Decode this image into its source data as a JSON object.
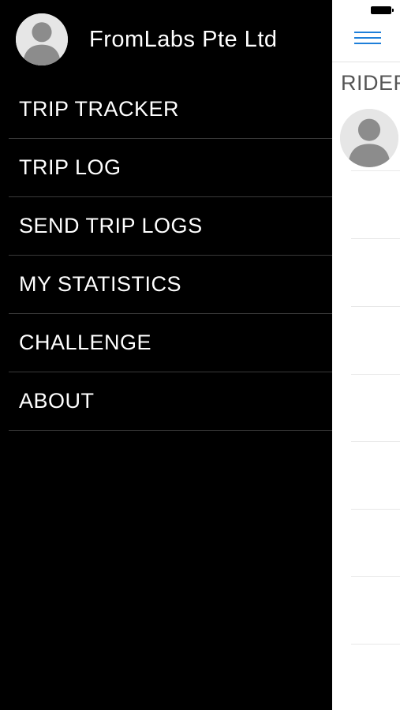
{
  "drawer": {
    "profile": {
      "name": "FromLabs Pte Ltd",
      "avatar_icon": "person-silhouette-icon"
    },
    "menu": [
      {
        "label": "TRIP TRACKER"
      },
      {
        "label": "TRIP LOG"
      },
      {
        "label": "SEND TRIP LOGS"
      },
      {
        "label": "MY STATISTICS"
      },
      {
        "label": "CHALLENGE"
      },
      {
        "label": "ABOUT"
      }
    ]
  },
  "main": {
    "menu_icon": "hamburger-icon",
    "section_label": "RIDER",
    "rider_avatar_icon": "person-silhouette-icon"
  },
  "status_bar": {
    "battery_icon": "battery-icon"
  },
  "colors": {
    "drawer_background": "#000000",
    "drawer_text": "#ffffff",
    "accent": "#1e7fd9",
    "avatar_background": "#e6e6e6",
    "avatar_silhouette": "#8c8c8c"
  }
}
